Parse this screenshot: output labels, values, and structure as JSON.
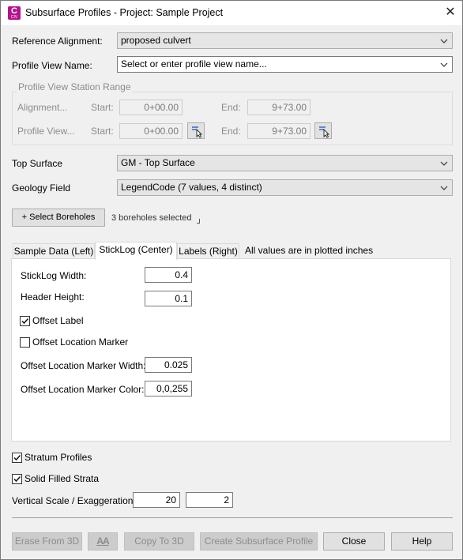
{
  "window": {
    "title": "Subsurface Profiles - Project: Sample Project",
    "app_icon_letter": "C",
    "app_icon_sub": "CIV",
    "close_glyph": "✕"
  },
  "reference_alignment": {
    "label": "Reference Alignment:",
    "value": "proposed culvert"
  },
  "profile_view_name": {
    "label": "Profile View Name:",
    "placeholder": "Select or enter profile view name..."
  },
  "station_range": {
    "title": "Profile View Station Range",
    "alignment_label": "Alignment...",
    "profile_view_label": "Profile View...",
    "start_label": "Start:",
    "end_label": "End:",
    "alignment_start": "0+00.00",
    "alignment_end": "9+73.00",
    "profile_start": "0+00.00",
    "profile_end": "9+73.00"
  },
  "top_surface": {
    "label": "Top Surface",
    "value": "GM - Top Surface"
  },
  "geology_field": {
    "label": "Geology Field",
    "value": "LegendCode (7 values, 4 distinct)"
  },
  "boreholes": {
    "button_label": "+ Select Boreholes",
    "status": "3 boreholes selected"
  },
  "tabs": [
    {
      "label": "Sample Data (Left)",
      "active": false
    },
    {
      "label": "StickLog (Center)",
      "active": true
    },
    {
      "label": "Labels (Right)",
      "active": false
    }
  ],
  "tabs_note": "All values are in plotted inches",
  "sticklog": {
    "width_label": "StickLog Width:",
    "width_value": "0.4",
    "header_label": "Header Height:",
    "header_value": "0.1",
    "offset_label": {
      "label": "Offset Label",
      "checked": true
    },
    "offset_marker": {
      "label": "Offset Location Marker",
      "checked": false
    },
    "marker_width_label": "Offset Location Marker Width:",
    "marker_width_value": "0.025",
    "marker_color_label": "Offset Location Marker Color:",
    "marker_color_value": "0,0,255"
  },
  "stratum_profiles": {
    "label": "Stratum Profiles",
    "checked": true
  },
  "solid_filled": {
    "label": "Solid Filled Strata",
    "checked": true
  },
  "vertical_scale": {
    "label": "Vertical Scale / Exaggeration:",
    "scale": "20",
    "exaggeration": "2"
  },
  "footer": {
    "erase_label": "Erase From 3D",
    "text_style_label": "AA",
    "copy_label": "Copy To 3D",
    "create_label": "Create Subsurface Profile",
    "close_label": "Close",
    "help_label": "Help"
  },
  "colors": {
    "app_icon": "#b3138e",
    "disabled_text": "#8c8c8c",
    "window_bg": "#f0f0f0"
  }
}
